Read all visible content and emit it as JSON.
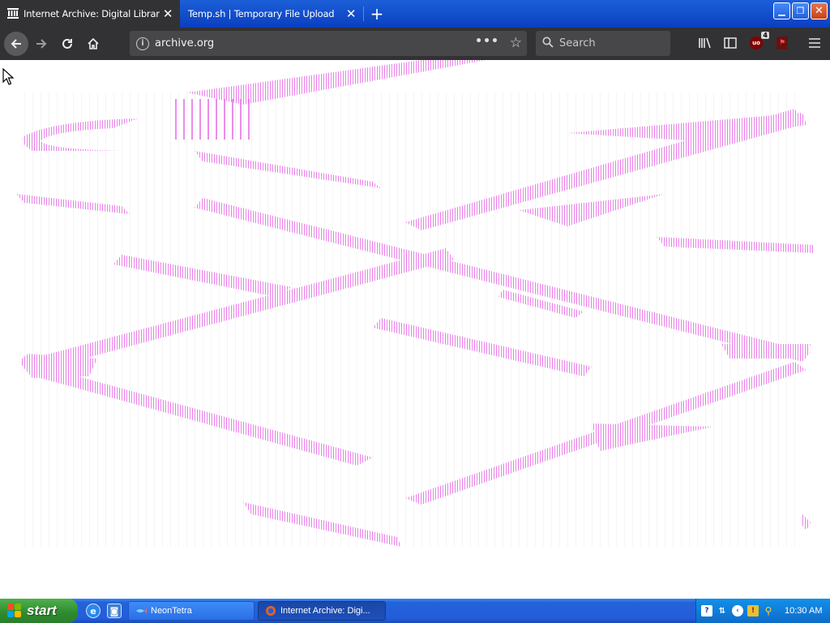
{
  "browser": {
    "tabs": [
      {
        "title": "Internet Archive: Digital Library of",
        "active": true
      },
      {
        "title": "Temp.sh | Temporary File Upload",
        "active": false
      }
    ],
    "url": "archive.org",
    "search_placeholder": "Search",
    "ublock_badge": "4",
    "ublock_label": "uo"
  },
  "taskbar": {
    "start_label": "start",
    "buttons": [
      {
        "label": "NeonTetra"
      },
      {
        "label": "Internet Archive: Digi..."
      }
    ],
    "clock": "10:30 AM"
  },
  "colors": {
    "tab_strip": "#0a3fbf",
    "toolbar": "#323234",
    "urlbar": "#474749",
    "artifact": "#e040e0",
    "taskbar": "#245ddb",
    "start_button": "#2d8a2d",
    "tray": "#0f7ad8"
  },
  "icons": {
    "tab1": "archive-building-icon",
    "back": "arrow-left-icon",
    "forward": "arrow-right-icon",
    "reload": "reload-icon",
    "home": "home-icon",
    "library": "library-icon",
    "sidebar": "sidebar-icon",
    "menu": "hamburger-menu-icon"
  }
}
